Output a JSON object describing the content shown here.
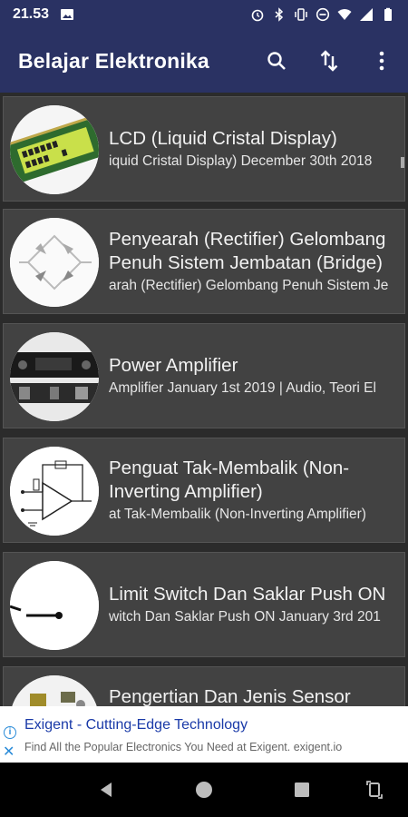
{
  "status_bar": {
    "time": "21.53",
    "icons": [
      "image-icon",
      "alarm-icon",
      "bluetooth-icon",
      "vibrate-icon",
      "dnd-icon",
      "wifi-icon",
      "signal-icon",
      "battery-icon"
    ]
  },
  "app_bar": {
    "title": "Belajar Elektronika",
    "actions": [
      "search-icon",
      "sort-icon",
      "more-vert-icon"
    ]
  },
  "articles": [
    {
      "title": "LCD (Liquid Cristal Display)",
      "subtitle": "iquid Cristal Display) December 30th 2018",
      "thumb": "lcd-module-thumbnail"
    },
    {
      "title": "Penyearah (Rectifier) Gelombang Penuh Sistem Jembatan (Bridge)",
      "subtitle": "arah (Rectifier) Gelombang Penuh Sistem Je",
      "thumb": "bridge-rectifier-diagram-thumbnail"
    },
    {
      "title": "Power Amplifier",
      "subtitle": "Amplifier January 1st 2019 | Audio, Teori El",
      "thumb": "power-amplifier-thumbnail"
    },
    {
      "title": "Penguat Tak-Membalik (Non-Inverting Amplifier)",
      "subtitle": "at Tak-Membalik (Non-Inverting Amplifier)",
      "thumb": "opamp-circuit-thumbnail"
    },
    {
      "title": "Limit Switch Dan Saklar Push ON",
      "subtitle": "witch Dan Saklar Push ON January 3rd 201",
      "thumb": "switch-symbol-thumbnail"
    },
    {
      "title": "Pengertian Dan Jenis Sensor",
      "subtitle": "",
      "thumb": "sensor-thumbnail"
    }
  ],
  "ad": {
    "title": "Exigent - Cutting-Edge Technology",
    "description": "Find All the Popular Electronics You Need at Exigent. exigent.io"
  },
  "nav_bar": {
    "buttons": [
      "back-icon",
      "home-icon",
      "recents-icon",
      "rotate-icon"
    ]
  }
}
